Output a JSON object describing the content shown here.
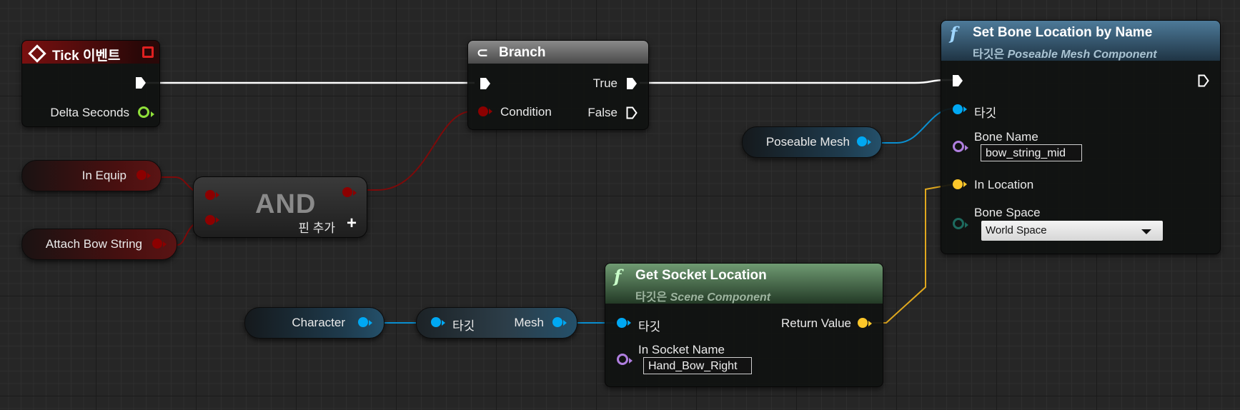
{
  "colors": {
    "exec": "#ffffff",
    "bool": "#8c0000",
    "object": "#00a8f3",
    "vector": "#fdc72a",
    "name": "#b07fe0",
    "float": "#8fe03a",
    "struct_teal": "#1d6a5e",
    "event_header": "#8a1414",
    "function_header": "#3f6b8c",
    "pure_header": "#4e7a4e"
  },
  "tick_event": {
    "title": "Tick 이벤트",
    "icon": "event-diamond-icon",
    "pin_delta": "Delta Seconds"
  },
  "branch": {
    "title": "Branch",
    "icon": "branch-icon",
    "pin_condition": "Condition",
    "pin_true": "True",
    "pin_false": "False"
  },
  "and_node": {
    "title": "AND",
    "add_pin": "핀 추가",
    "add_icon": "plus-icon"
  },
  "vars": {
    "in_equip": "In Equip",
    "attach_bow_string": "Attach Bow String",
    "poseable_mesh": "Poseable Mesh",
    "character": "Character"
  },
  "mesh_getter": {
    "target": "타깃",
    "output": "Mesh"
  },
  "set_bone": {
    "title": "Set Bone Location by Name",
    "subtitle_prefix": "타깃은",
    "subtitle_class": "Poseable Mesh Component",
    "pin_target": "타깃",
    "pin_bone_name": "Bone Name",
    "bone_name_value": "bow_string_mid",
    "pin_in_location": "In Location",
    "pin_bone_space": "Bone Space",
    "bone_space_value": "World Space"
  },
  "get_socket": {
    "title": "Get Socket Location",
    "subtitle_prefix": "타깃은",
    "subtitle_class": "Scene Component",
    "pin_target": "타깃",
    "pin_return": "Return Value",
    "pin_socket_name": "In Socket Name",
    "socket_name_value": "Hand_Bow_Right"
  }
}
